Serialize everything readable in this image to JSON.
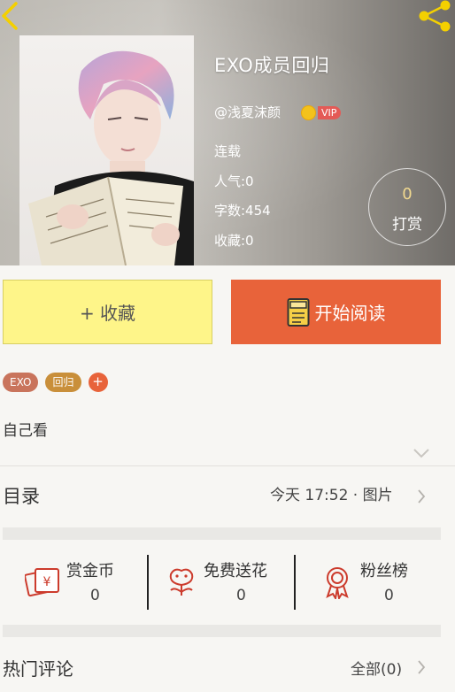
{
  "header": {
    "title": "EXO成员回归",
    "author": "@浅夏沫颜",
    "vip_label": "VIP",
    "status": "连载",
    "popularity": "人气:0",
    "word_count": "字数:454",
    "favorites": "收藏:0",
    "tip_count": "0",
    "tip_label": "打赏"
  },
  "actions": {
    "collect_label": "+ 收藏",
    "read_label": "开始阅读"
  },
  "tags": [
    {
      "label": "EXO",
      "color": "#c9745c"
    },
    {
      "label": "回归",
      "color": "#c98f3a"
    }
  ],
  "tag_add_label": "+",
  "summary": "自己看",
  "toc": {
    "title": "目录",
    "update": "今天 17:52 · 图片"
  },
  "stats": [
    {
      "label": "赏金币",
      "value": "0",
      "icon": "coin-card-icon"
    },
    {
      "label": "免费送花",
      "value": "0",
      "icon": "flower-icon"
    },
    {
      "label": "粉丝榜",
      "value": "0",
      "icon": "award-ribbon-icon"
    }
  ],
  "comments": {
    "title": "热门评论",
    "all_label": "全部(0)"
  },
  "colors": {
    "accent": "#e8633a",
    "collect_bg": "#fef589",
    "icon_red": "#cc3b2c"
  }
}
